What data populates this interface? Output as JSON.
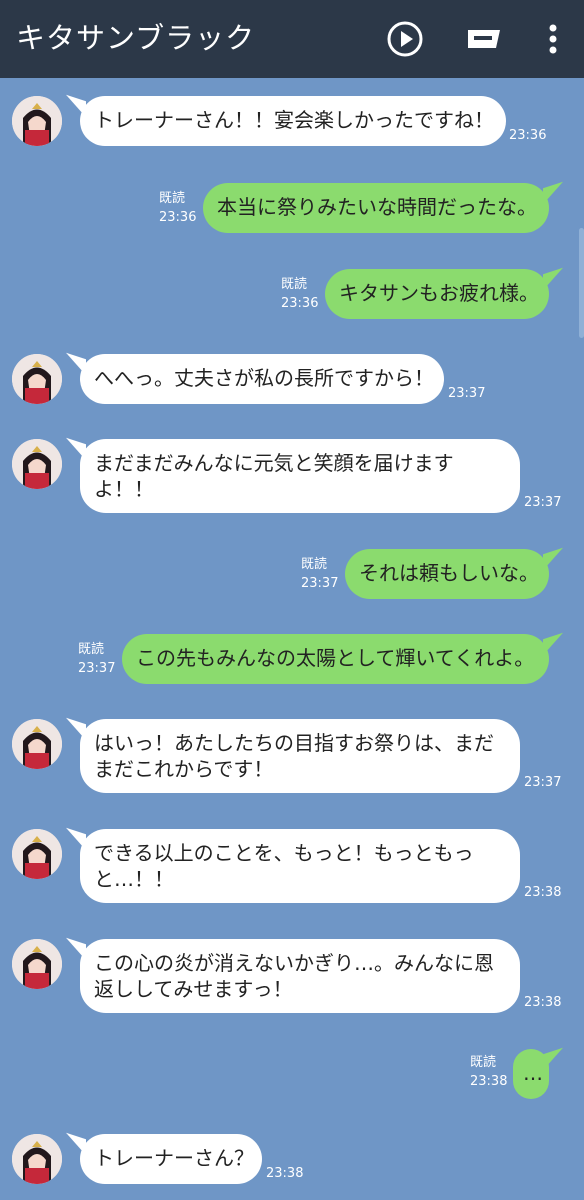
{
  "header": {
    "title": "キタサンブラック"
  },
  "messages": [
    {
      "side": "in",
      "text": "トレーナーさん！！宴会楽しかったですね！",
      "time": "23:36"
    },
    {
      "side": "out",
      "read": "既読",
      "text": "本当に祭りみたいな時間だったな。",
      "time": "23:36"
    },
    {
      "side": "out",
      "read": "既読",
      "text": "キタサンもお疲れ様。",
      "time": "23:36"
    },
    {
      "side": "in",
      "text": "へへっ。丈夫さが私の長所ですから！",
      "time": "23:37"
    },
    {
      "side": "in",
      "text": "まだまだみんなに元気と笑顔を届けますよ！！",
      "time": "23:37"
    },
    {
      "side": "out",
      "read": "既読",
      "text": "それは頼もしいな。",
      "time": "23:37"
    },
    {
      "side": "out",
      "read": "既読",
      "text": "この先もみんなの太陽として輝いてくれよ。",
      "time": "23:37"
    },
    {
      "side": "in",
      "text": "はいっ！あたしたちの目指すお祭りは、まだまだこれからです！",
      "time": "23:37"
    },
    {
      "side": "in",
      "text": "できる以上のことを、もっと！もっともっと…！！",
      "time": "23:38"
    },
    {
      "side": "in",
      "text": "この心の炎が消えないかぎり…。みんなに恩返ししてみせますっ！",
      "time": "23:38"
    },
    {
      "side": "out",
      "read": "既読",
      "text": "…",
      "time": "23:38"
    },
    {
      "side": "in",
      "text": "トレーナーさん？",
      "time": "23:38"
    }
  ],
  "colors": {
    "header": "#2c3848",
    "background": "#6f96c6",
    "incoming": "#ffffff",
    "outgoing": "#8bdb6e"
  },
  "icons": [
    "play-icon",
    "keyboard-icon",
    "menu-icon"
  ]
}
